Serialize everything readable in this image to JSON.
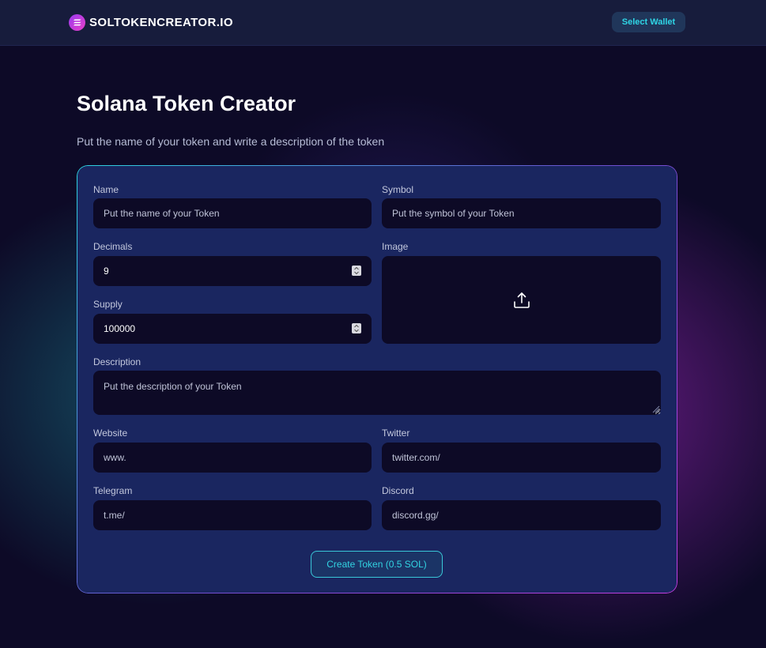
{
  "header": {
    "brand": "SOLTOKENCREATOR.IO",
    "wallet_button": "Select Wallet"
  },
  "page": {
    "title": "Solana Token Creator",
    "subtitle": "Put the name of your token and write a description of the token"
  },
  "form": {
    "name": {
      "label": "Name",
      "placeholder": "Put the name of your Token"
    },
    "symbol": {
      "label": "Symbol",
      "placeholder": "Put the symbol of your Token"
    },
    "decimals": {
      "label": "Decimals",
      "value": "9"
    },
    "image": {
      "label": "Image",
      "icon": "upload-icon"
    },
    "supply": {
      "label": "Supply",
      "value": "100000"
    },
    "description": {
      "label": "Description",
      "placeholder": "Put the description of your Token"
    },
    "website": {
      "label": "Website",
      "value": "www."
    },
    "twitter": {
      "label": "Twitter",
      "value": "twitter.com/"
    },
    "telegram": {
      "label": "Telegram",
      "value": "t.me/"
    },
    "discord": {
      "label": "Discord",
      "value": "discord.gg/"
    },
    "submit": "Create Token (0.5 SOL)"
  },
  "colors": {
    "accent_cyan": "#2fd6e6",
    "accent_purple": "#c23ee0",
    "card_bg": "#1a2660",
    "input_bg": "#0d0a26"
  }
}
